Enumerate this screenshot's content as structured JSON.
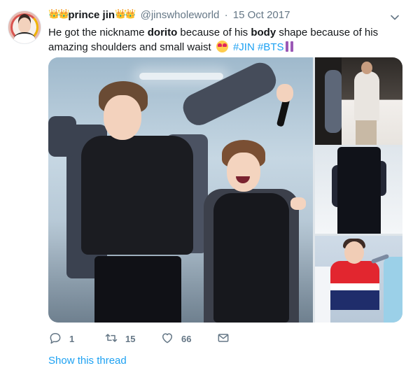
{
  "tweet": {
    "author_name": "prince jin",
    "handle": "@jinswholeworld",
    "separator": "·",
    "date": "15 Oct 2017",
    "crown_left": "👑👑",
    "crown_right": "👑👑",
    "text": {
      "part1": "He got the nickname ",
      "bold1": "dorito",
      "part2": "  because of his ",
      "bold2": "body",
      "part3": " shape because of his amazing shoulders and small waist ",
      "hashtag1": "#JIN",
      "hashtag2": "#BTS"
    }
  },
  "media": {
    "images": [
      {
        "icon": "main-photo-two-performers"
      },
      {
        "icon": "photo-two-men-street"
      },
      {
        "icon": "photo-back-view-dark-suit"
      },
      {
        "icon": "photo-red-white-shirt-singer"
      }
    ]
  },
  "actions": {
    "reply_count": "1",
    "retweet_count": "15",
    "like_count": "66",
    "icons": [
      "reply-icon",
      "retweet-icon",
      "like-icon",
      "direct-message-icon"
    ]
  },
  "footer": {
    "show_thread": "Show this thread"
  },
  "colors": {
    "link": "#1da1f2",
    "muted": "#657786",
    "text": "#14171a"
  }
}
